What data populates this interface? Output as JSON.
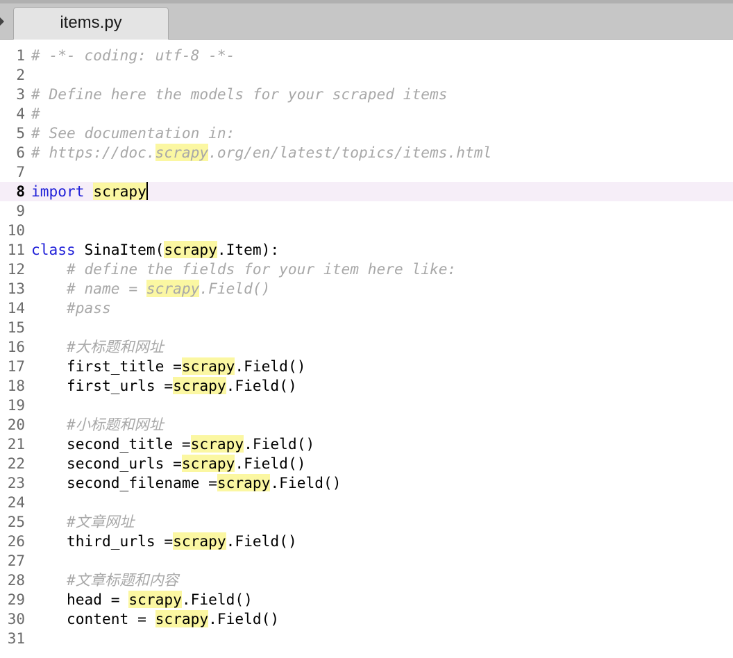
{
  "tab": {
    "filename": "items.py"
  },
  "editor": {
    "current_line": 8,
    "lines": [
      {
        "n": "1",
        "tokens": [
          {
            "t": "# -*- coding: utf-8 -*-",
            "c": "comment"
          }
        ]
      },
      {
        "n": "2",
        "tokens": []
      },
      {
        "n": "3",
        "tokens": [
          {
            "t": "# Define here the models for your scraped items",
            "c": "comment"
          }
        ]
      },
      {
        "n": "4",
        "tokens": [
          {
            "t": "#",
            "c": "comment"
          }
        ]
      },
      {
        "n": "5",
        "tokens": [
          {
            "t": "# See documentation in:",
            "c": "comment"
          }
        ]
      },
      {
        "n": "6",
        "tokens": [
          {
            "t": "# https://doc.",
            "c": "comment"
          },
          {
            "t": "scrapy",
            "c": "comment hl"
          },
          {
            "t": ".org/en/latest/topics/items.html",
            "c": "comment"
          }
        ]
      },
      {
        "n": "7",
        "tokens": []
      },
      {
        "n": "8",
        "tokens": [
          {
            "t": "import",
            "c": "kw"
          },
          {
            "t": " "
          },
          {
            "t": "scrapy",
            "c": "hl"
          }
        ],
        "cursor": true
      },
      {
        "n": "9",
        "tokens": []
      },
      {
        "n": "10",
        "tokens": []
      },
      {
        "n": "11",
        "tokens": [
          {
            "t": "class",
            "c": "kw"
          },
          {
            "t": " SinaItem("
          },
          {
            "t": "scrapy",
            "c": "hl"
          },
          {
            "t": ".Item):"
          }
        ]
      },
      {
        "n": "12",
        "tokens": [
          {
            "t": "    "
          },
          {
            "t": "# define the fields for your item here like:",
            "c": "comment"
          }
        ]
      },
      {
        "n": "13",
        "tokens": [
          {
            "t": "    "
          },
          {
            "t": "# name = ",
            "c": "comment"
          },
          {
            "t": "scrapy",
            "c": "comment hl"
          },
          {
            "t": ".Field()",
            "c": "comment"
          }
        ]
      },
      {
        "n": "14",
        "tokens": [
          {
            "t": "    "
          },
          {
            "t": "#pass",
            "c": "comment"
          }
        ]
      },
      {
        "n": "15",
        "tokens": []
      },
      {
        "n": "16",
        "tokens": [
          {
            "t": "    "
          },
          {
            "t": "#大标题和网址",
            "c": "comment"
          }
        ]
      },
      {
        "n": "17",
        "tokens": [
          {
            "t": "    first_title ="
          },
          {
            "t": "scrapy",
            "c": "hl"
          },
          {
            "t": ".Field()"
          }
        ]
      },
      {
        "n": "18",
        "tokens": [
          {
            "t": "    first_urls ="
          },
          {
            "t": "scrapy",
            "c": "hl"
          },
          {
            "t": ".Field()"
          }
        ]
      },
      {
        "n": "19",
        "tokens": []
      },
      {
        "n": "20",
        "tokens": [
          {
            "t": "    "
          },
          {
            "t": "#小标题和网址",
            "c": "comment"
          }
        ]
      },
      {
        "n": "21",
        "tokens": [
          {
            "t": "    second_title ="
          },
          {
            "t": "scrapy",
            "c": "hl"
          },
          {
            "t": ".Field()"
          }
        ]
      },
      {
        "n": "22",
        "tokens": [
          {
            "t": "    second_urls ="
          },
          {
            "t": "scrapy",
            "c": "hl"
          },
          {
            "t": ".Field()"
          }
        ]
      },
      {
        "n": "23",
        "tokens": [
          {
            "t": "    second_filename ="
          },
          {
            "t": "scrapy",
            "c": "hl"
          },
          {
            "t": ".Field()"
          }
        ]
      },
      {
        "n": "24",
        "tokens": []
      },
      {
        "n": "25",
        "tokens": [
          {
            "t": "    "
          },
          {
            "t": "#文章网址",
            "c": "comment"
          }
        ]
      },
      {
        "n": "26",
        "tokens": [
          {
            "t": "    third_urls ="
          },
          {
            "t": "scrapy",
            "c": "hl"
          },
          {
            "t": ".Field()"
          }
        ]
      },
      {
        "n": "27",
        "tokens": []
      },
      {
        "n": "28",
        "tokens": [
          {
            "t": "    "
          },
          {
            "t": "#文章标题和内容",
            "c": "comment"
          }
        ]
      },
      {
        "n": "29",
        "tokens": [
          {
            "t": "    head = "
          },
          {
            "t": "scrapy",
            "c": "hl"
          },
          {
            "t": ".Field()"
          }
        ]
      },
      {
        "n": "30",
        "tokens": [
          {
            "t": "    content = "
          },
          {
            "t": "scrapy",
            "c": "hl"
          },
          {
            "t": ".Field()"
          }
        ]
      },
      {
        "n": "31",
        "tokens": []
      }
    ]
  },
  "colors": {
    "keyword": "#1f1fd8",
    "comment": "#a8a8a8",
    "highlight": "#fbf7a2",
    "current_line_bg": "#f6eef8"
  }
}
